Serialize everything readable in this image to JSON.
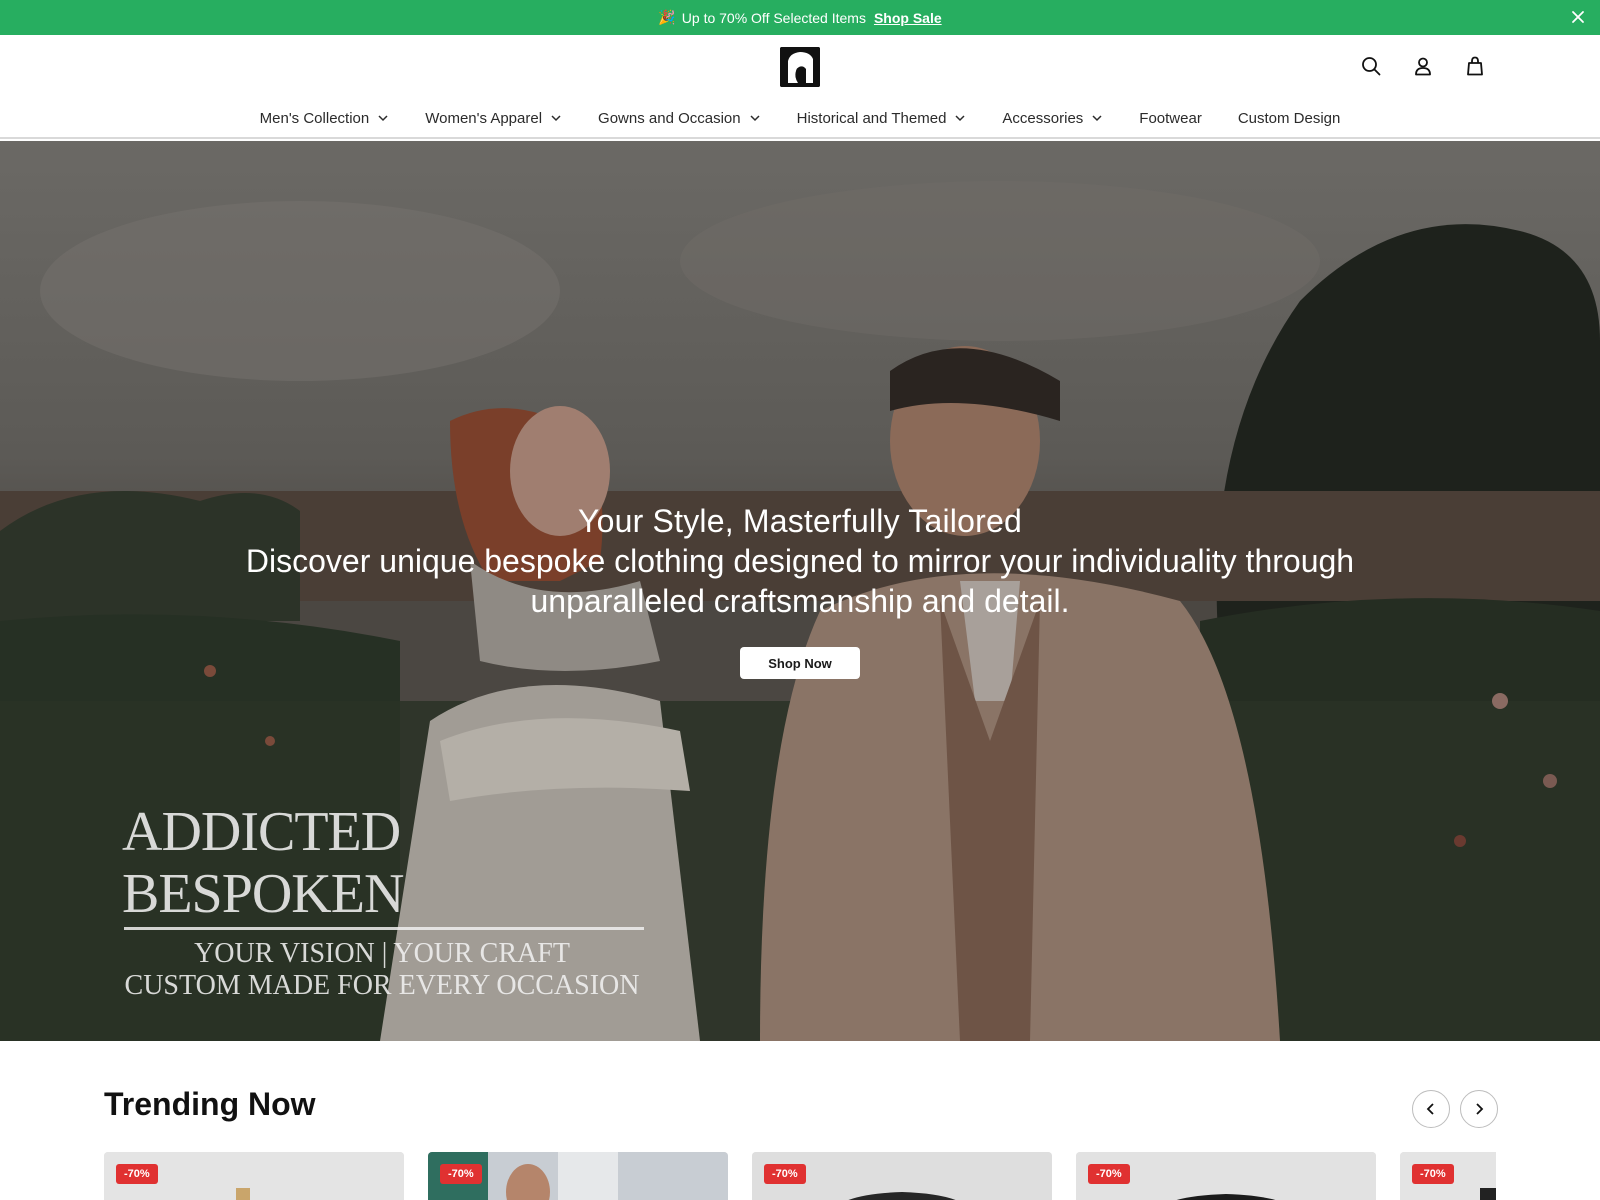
{
  "announcement": {
    "emoji": "🎉",
    "text": "Up to 70% Off Selected Items",
    "link_text": "Shop Sale"
  },
  "nav": {
    "items": [
      {
        "label": "Men's Collection",
        "has_dropdown": true
      },
      {
        "label": "Women's Apparel",
        "has_dropdown": true
      },
      {
        "label": "Gowns and Occasion",
        "has_dropdown": true
      },
      {
        "label": "Historical and Themed",
        "has_dropdown": true
      },
      {
        "label": "Accessories",
        "has_dropdown": true
      },
      {
        "label": "Footwear",
        "has_dropdown": false
      },
      {
        "label": "Custom Design",
        "has_dropdown": false
      }
    ]
  },
  "header_icons": [
    "search-icon",
    "account-icon",
    "cart-icon"
  ],
  "hero": {
    "title": "Your Style, Masterfully Tailored",
    "subtitle": "Discover unique bespoke clothing designed to mirror your individuality through unparalleled craftsmanship and detail.",
    "cta": "Shop Now",
    "brand_line1": "ADDICTED BESPOKEN",
    "brand_line2": "YOUR VISION | YOUR CRAFT",
    "brand_line3": "CUSTOM MADE FOR EVERY OCCASION"
  },
  "trending": {
    "title": "Trending Now",
    "products": [
      {
        "badge": "-70%"
      },
      {
        "badge": "-70%"
      },
      {
        "badge": "-70%"
      },
      {
        "badge": "-70%"
      },
      {
        "badge": "-70%"
      }
    ]
  },
  "colors": {
    "announce_bg": "#27ae60",
    "badge_bg": "#e03131",
    "text": "#1a1a1a"
  }
}
